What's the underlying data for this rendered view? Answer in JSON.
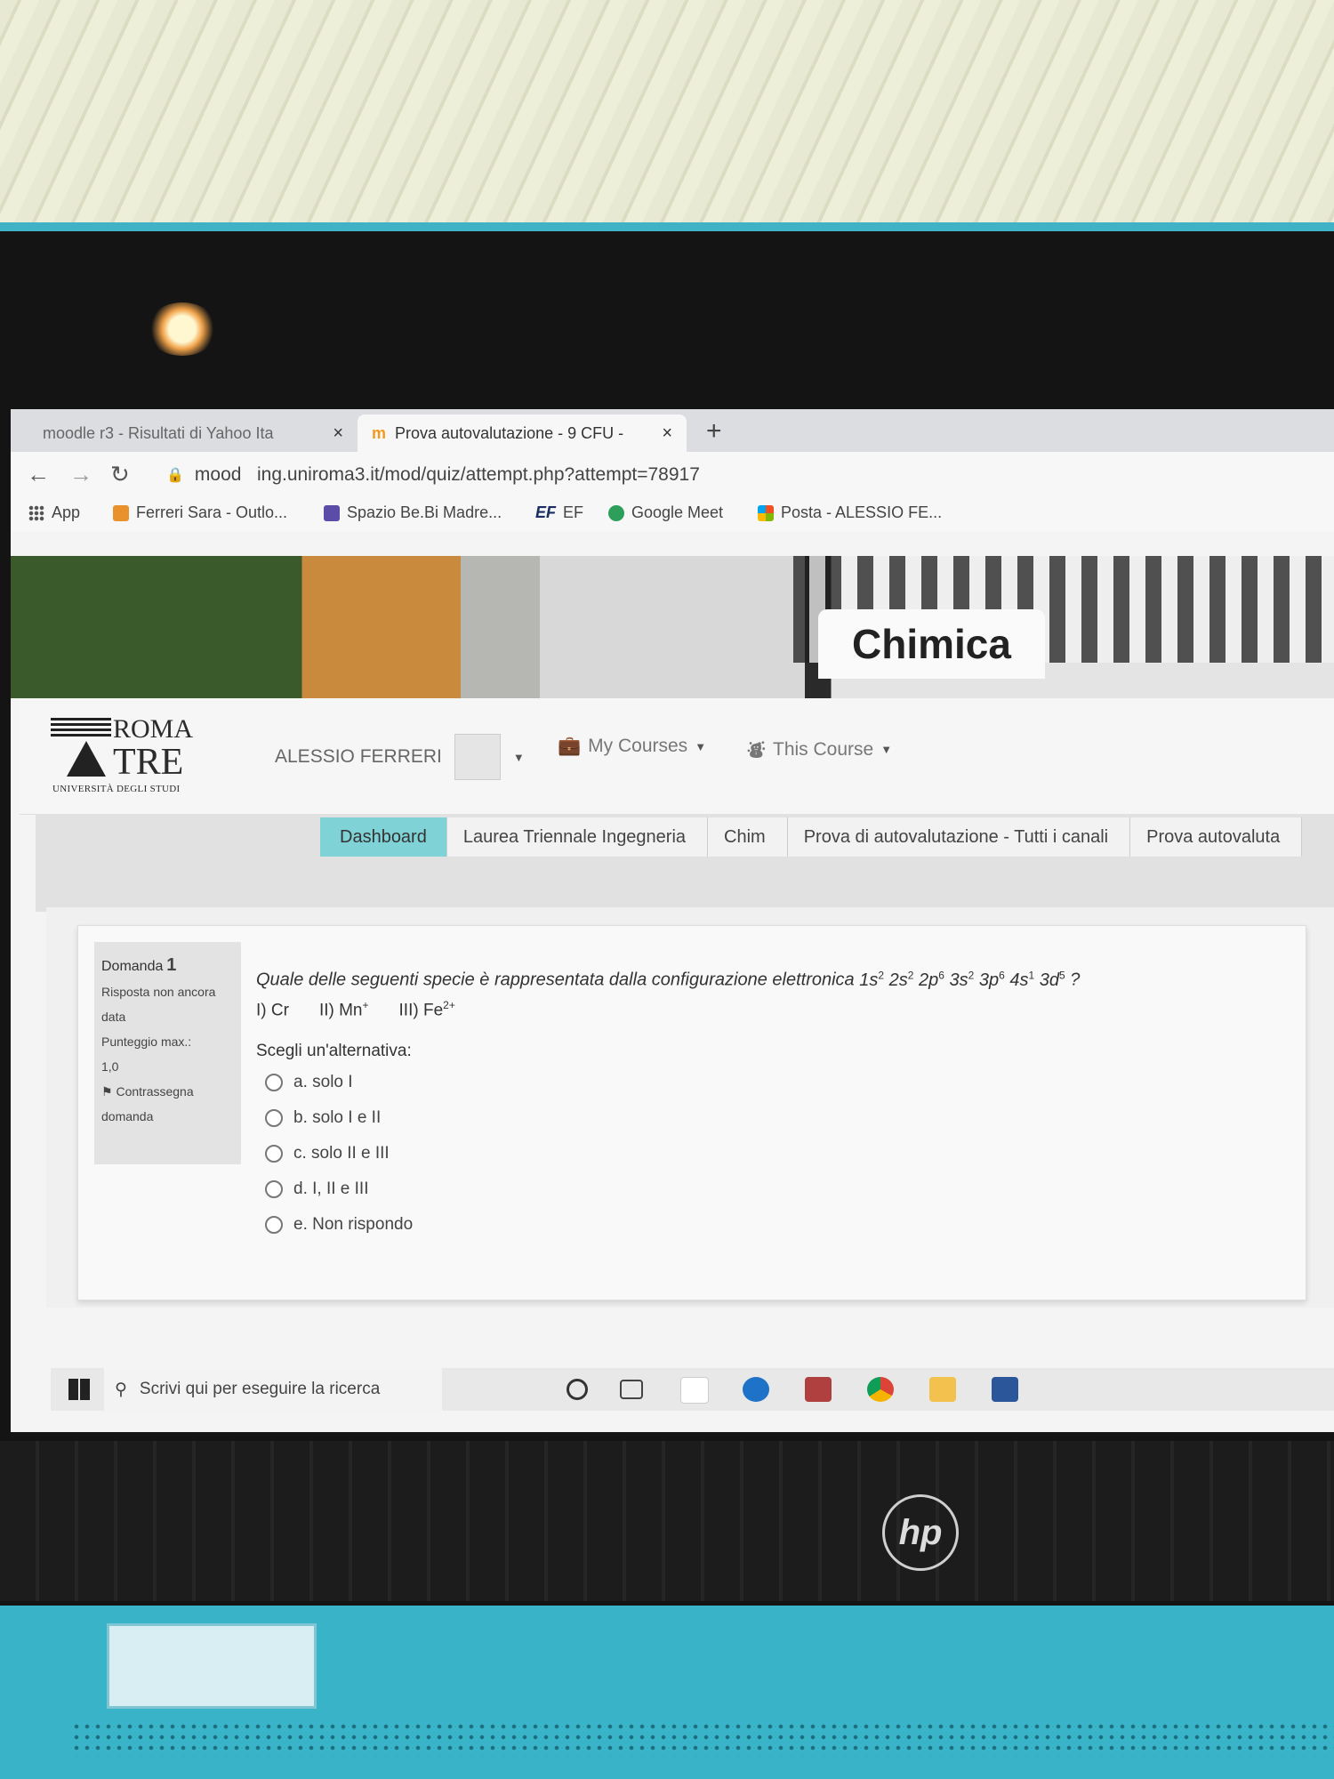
{
  "browser": {
    "tabs": [
      {
        "label": "moodle r3 - Risultati di Yahoo Ita",
        "close": "×"
      },
      {
        "label": "Prova autovalutazione - 9 CFU -",
        "close": "×",
        "favicon": "m"
      }
    ],
    "new_tab": "+",
    "url_prefix": "mood",
    "url_rest": "ing.uniroma3.it/mod/quiz/attempt.php?attempt=78917",
    "bookmarks": [
      {
        "label": "App"
      },
      {
        "label": "Ferreri Sara - Outlo..."
      },
      {
        "label": "Spazio Be.Bi Madre..."
      },
      {
        "label": "EF",
        "icon_text": "EF"
      },
      {
        "label": "Google Meet"
      },
      {
        "label": "Posta - ALESSIO FE..."
      }
    ]
  },
  "banner": {
    "course_title": "Chimica"
  },
  "navbar": {
    "logo": {
      "line1": "ROMA",
      "line2": "TRE",
      "line3": "UNIVERSITÀ DEGLI STUDI"
    },
    "user_name": "ALESSIO FERRERI",
    "my_courses": "My Courses",
    "this_course": "This Course"
  },
  "breadcrumb": [
    "Dashboard",
    "Laurea Triennale Ingegneria",
    "Chim",
    "Prova di autovalutazione - Tutti i canali",
    "Prova autovaluta"
  ],
  "question": {
    "label": "Domanda",
    "number": "1",
    "status": "Risposta non ancora data",
    "max_score_label": "Punteggio max.:",
    "max_score": "1,0",
    "flag": "Contrassegna domanda",
    "text": "Quale delle seguenti specie è rappresentata dalla configurazione elettronica",
    "config": [
      {
        "orb": "1s",
        "e": "2"
      },
      {
        "orb": "2s",
        "e": "2"
      },
      {
        "orb": "2p",
        "e": "6"
      },
      {
        "orb": "3s",
        "e": "2"
      },
      {
        "orb": "3p",
        "e": "6"
      },
      {
        "orb": "4s",
        "e": "1"
      },
      {
        "orb": "3d",
        "e": "5"
      }
    ],
    "qmark": "?",
    "species": [
      {
        "label": "I) Cr",
        "charge": ""
      },
      {
        "label": "II) Mn",
        "charge": "+"
      },
      {
        "label": "III) Fe",
        "charge": "2+"
      }
    ],
    "choose": "Scegli un'alternativa:",
    "answers": [
      "a. solo I",
      "b. solo I e II",
      "c. solo II e III",
      "d. I, II e III",
      "e. Non rispondo"
    ]
  },
  "taskbar": {
    "search_placeholder": "Scrivi qui per eseguire la ricerca"
  },
  "laptop": {
    "brand": "hp"
  }
}
